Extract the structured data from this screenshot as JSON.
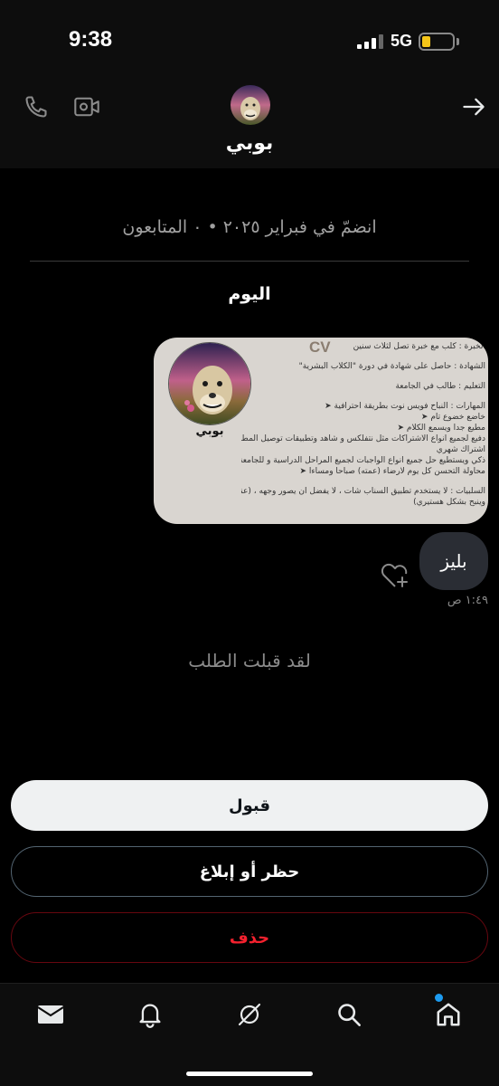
{
  "status_bar": {
    "time": "9:38",
    "network": "5G",
    "battery_level": 0.2,
    "battery_color": "#f5c518"
  },
  "header": {
    "contact_name": "بوبي",
    "phone_icon": "phone-icon",
    "video_icon": "video-call-icon",
    "back_icon": "arrow-right-icon"
  },
  "conversation": {
    "joined_info": "انضمّ في فبراير ٢٠٢٥ • ٠ المتابعون",
    "day_label": "اليوم",
    "cv_image": {
      "title": "CV",
      "name": "بوبي",
      "lines": [
        "الخبرة : كلب مع خبرة تصل لثلاث سنين",
        "",
        "الشهادة : حاصل على شهادة في دورة \"الكلاب البشرية\"",
        "",
        "التعليم : طالب في الجامعة",
        "",
        "المهارات : النباح فويس نوت بطريقة احترافية ➤",
        "خاضع خضوع تام ➤",
        "مطيع جدا ويسمع الكلام ➤",
        "دفيع لجميع انواع الاشتراكات مثل نتفلكس و شاهد وتطبيقات توصيل المطاعم وأي تطبيق يوجد به ➤",
        "اشتراك شهري",
        "ذكي ويستطيع حل جميع انواع الواجبات لجميع المراحل الدراسية و للجامعة ➤",
        "محاولة التحسن كل يوم لارضاء (عمته) صباحا ومساءا ➤",
        "",
        "السلبيات : لا يستخدم تطبيق السناب شات ، لا يفضل ان يصور وجهه ، (عندما يرى الاقدام يجن جنونه",
        "وينبح بشكل هستيري)"
      ]
    },
    "message_text": "بليز",
    "message_time": "١:٤٩ ص",
    "reaction_icon": "heart-plus-icon",
    "accepted_text": "لقد قبلت الطلب"
  },
  "actions": {
    "accept_label": "قبول",
    "block_label": "حظر أو إبلاغ",
    "delete_label": "حذف"
  },
  "bottom_nav": {
    "items": [
      "mail-icon",
      "bell-icon",
      "grok-icon",
      "search-icon",
      "home-icon"
    ],
    "accent": "#1d9bf0"
  }
}
